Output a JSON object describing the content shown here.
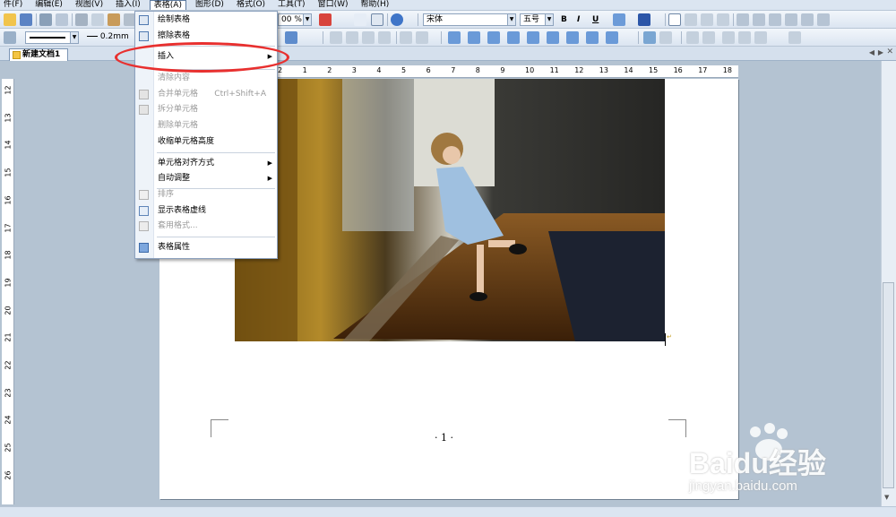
{
  "menubar": {
    "items": [
      "件(F)",
      "编辑(E)",
      "视图(V)",
      "插入(I)",
      "表格(A)",
      "图形(D)",
      "格式(O)",
      "工具(T)",
      "窗口(W)",
      "帮助(H)"
    ]
  },
  "toolbar1": {
    "zoom": "00 %",
    "font_name": "宋体",
    "font_size": "五号",
    "bold_label": "B",
    "italic_label": "I",
    "underline_label": "U"
  },
  "toolbar2": {
    "line_width": "0.2mm"
  },
  "tabs": [
    {
      "label": "新建文档1"
    }
  ],
  "ruler": {
    "horizontal": [
      "2",
      "1",
      "2",
      "3",
      "4",
      "5",
      "6",
      "7",
      "8",
      "9",
      "10",
      "11",
      "12",
      "13",
      "14",
      "15",
      "16",
      "17",
      "18"
    ],
    "vertical": [
      "12",
      "13",
      "14",
      "15",
      "16",
      "17",
      "18",
      "19",
      "20",
      "21",
      "22",
      "23",
      "24",
      "25",
      "26"
    ]
  },
  "dropdown": {
    "items": [
      {
        "label": "绘制表格",
        "icon": "draw-table-icon",
        "disabled": false
      },
      {
        "label": "擦除表格",
        "icon": "erase-table-icon",
        "disabled": false
      },
      {
        "label": "插入",
        "submenu": true,
        "disabled": false
      },
      {
        "label": "清除内容",
        "disabled": true
      },
      {
        "label": "合并单元格",
        "shortcut": "Ctrl+Shift+A",
        "icon": "merge-cells-icon",
        "disabled": true
      },
      {
        "label": "拆分单元格",
        "icon": "split-cells-icon",
        "disabled": true
      },
      {
        "label": "删除单元格",
        "disabled": true
      },
      {
        "label": "收缩单元格高度",
        "disabled": false
      },
      {
        "label": "单元格对齐方式",
        "submenu": true,
        "disabled": false
      },
      {
        "label": "自动调整",
        "submenu": true,
        "disabled": false
      },
      {
        "label": "排序",
        "icon": "sort-icon",
        "disabled": true
      },
      {
        "label": "显示表格虚线",
        "icon": "table-gridlines-icon",
        "disabled": false
      },
      {
        "label": "套用格式...",
        "icon": "table-format-icon",
        "disabled": true
      },
      {
        "label": "表格属性",
        "icon": "table-properties-icon",
        "disabled": false
      }
    ]
  },
  "page": {
    "page_number": "· 1 ·"
  },
  "watermark": {
    "brand": "Baidu经验",
    "url": "jingyan.baidu.com"
  },
  "colors": {
    "highlight": "#e8302f",
    "menu_active_border": "#5c7aa0",
    "background": "#b4c3d2"
  }
}
